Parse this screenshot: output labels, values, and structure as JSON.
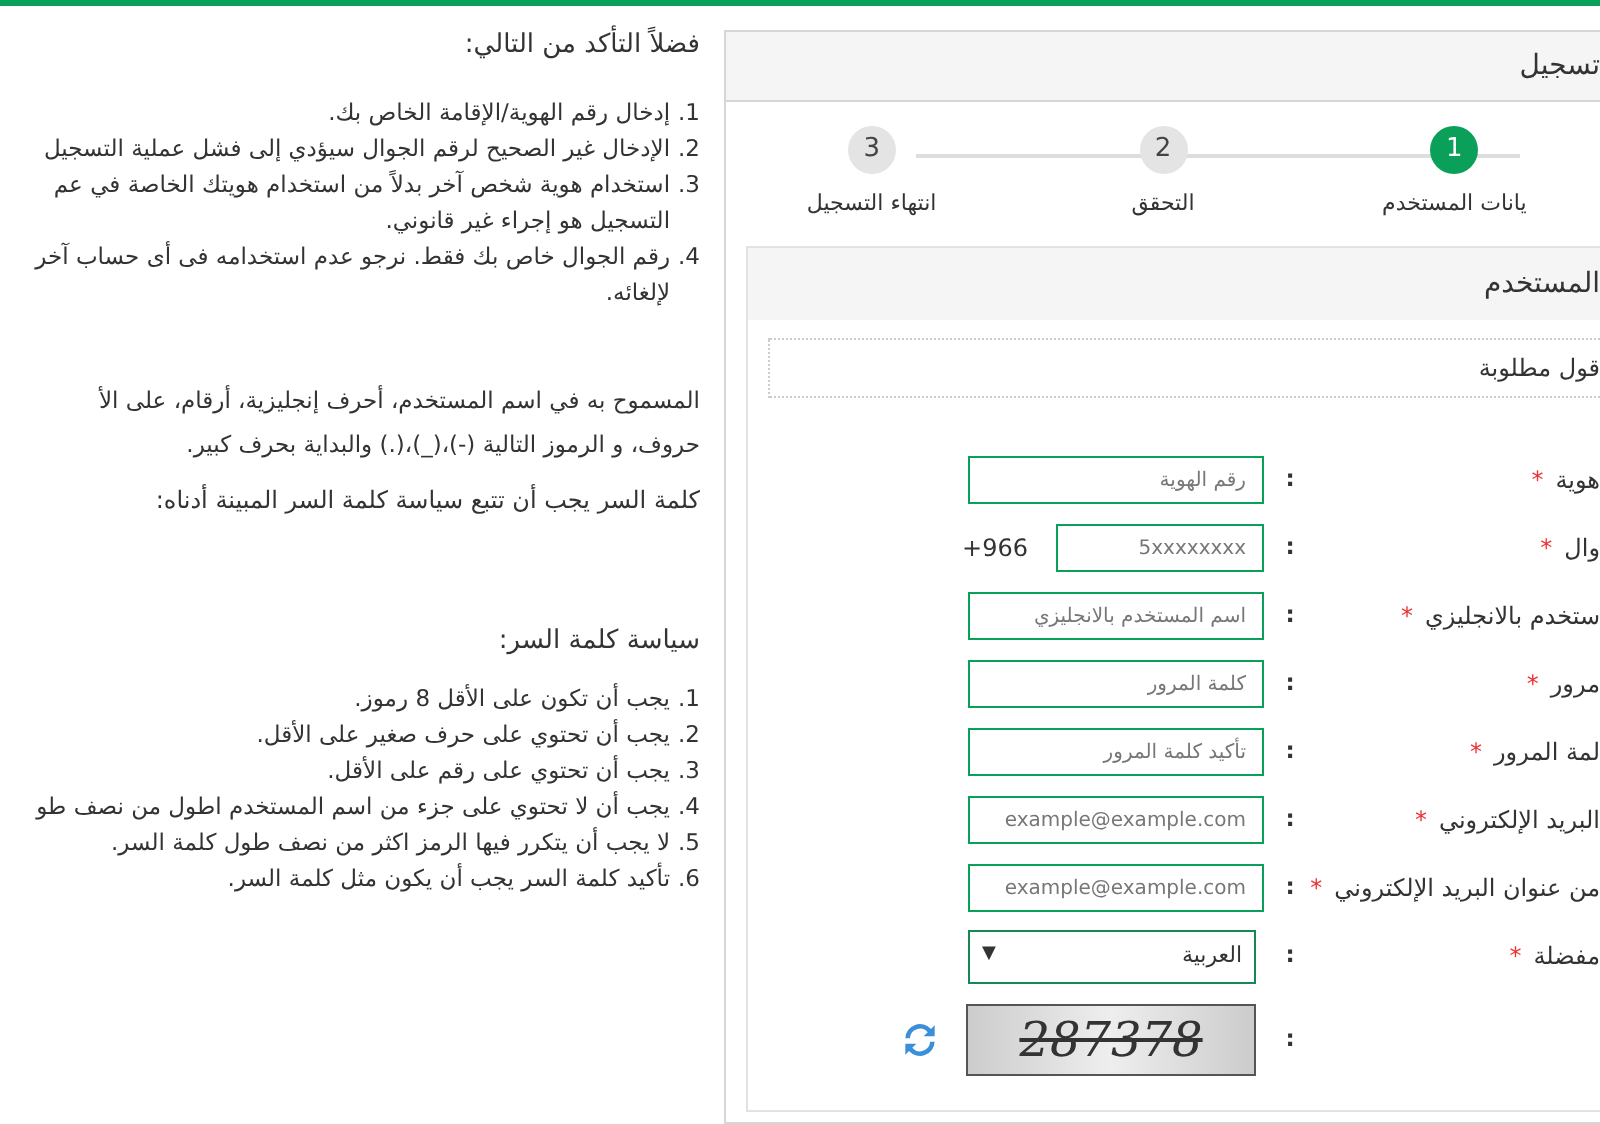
{
  "notes": {
    "title": "فضلاً التأكد من التالي:",
    "items": [
      {
        "number": "1.",
        "lines": [
          "إدخال رقم الهوية/الإقامة الخاص بك."
        ]
      },
      {
        "number": "2.",
        "lines": [
          "الإدخال غير الصحيح لرقم الجوال سيؤدي إلى فشل عملية التسجيل"
        ]
      },
      {
        "number": "3.",
        "lines": [
          "استخدام هوية شخص آخر بدلاً من استخدام هويتك الخاصة في عم",
          "التسجيل هو إجراء غير قانوني."
        ]
      },
      {
        "number": "4.",
        "lines": [
          "رقم الجوال خاص بك فقط. نرجو عدم استخدامه فى أى حساب آخر",
          "لإلغائه."
        ]
      }
    ]
  },
  "username_rules": {
    "lines": [
      "المسموح به في اسم المستخدم، أحرف إنجليزية، أرقام، على الأ",
      "حروف، و الرموز التالية (-)،(_)،(.) والبداية بحرف كبير."
    ]
  },
  "password_note": "كلمة السر يجب أن تتبع سياسة كلمة السر المبينة أدناه:",
  "policy": {
    "title": "سياسة كلمة السر:",
    "items": [
      {
        "number": "1.",
        "lines": [
          "يجب أن تكون على الأقل 8 رموز."
        ]
      },
      {
        "number": "2.",
        "lines": [
          "يجب أن تحتوي على حرف صغير على الأقل."
        ]
      },
      {
        "number": "3.",
        "lines": [
          "يجب أن تحتوي على رقم على الأقل."
        ]
      },
      {
        "number": "4.",
        "lines": [
          "يجب أن لا تحتوي على جزء من اسم المستخدم اطول من نصف طو"
        ]
      },
      {
        "number": "5.",
        "lines": [
          "لا يجب أن يتكرر فيها الرمز اكثر من نصف طول كلمة السر."
        ]
      },
      {
        "number": "6.",
        "lines": [
          "تأكيد كلمة السر يجب أن يكون مثل كلمة السر."
        ]
      }
    ]
  },
  "registration": {
    "title": "تسجيل",
    "steps": [
      {
        "number": "1",
        "label": "يانات المستخدم",
        "selected": true
      },
      {
        "number": "2",
        "label": "التحقق",
        "selected": false
      },
      {
        "number": "3",
        "label": "انتهاء التسجيل",
        "selected": false
      }
    ],
    "user_card": {
      "title": "المستخدم",
      "required_note": "قول مطلوبة",
      "fields": [
        {
          "kind": "text",
          "label": "هوية",
          "required_mark": "*",
          "separator": ":",
          "placeholder": "رقم الهوية"
        },
        {
          "kind": "phone",
          "label": "وال",
          "required_mark": "*",
          "separator": ":",
          "prefix": "+966",
          "placeholder": "5xxxxxxxx"
        },
        {
          "kind": "text",
          "label": "ستخدم بالانجليزي",
          "required_mark": "*",
          "separator": ":",
          "placeholder": "اسم المستخدم بالانجليزي"
        },
        {
          "kind": "text",
          "label": "مرور",
          "required_mark": "*",
          "separator": ":",
          "placeholder": "كلمة المرور"
        },
        {
          "kind": "text",
          "label": "لمة المرور",
          "required_mark": "*",
          "separator": ":",
          "placeholder": "تأكيد كلمة المرور"
        },
        {
          "kind": "text",
          "label": "البريد الإلكتروني",
          "required_mark": "*",
          "separator": ":",
          "placeholder": "example@example.com"
        },
        {
          "kind": "text",
          "label": "من عنوان البريد الإلكتروني",
          "required_mark": "*",
          "separator": ":",
          "placeholder": "example@example.com"
        },
        {
          "kind": "select",
          "label": "مفضلة",
          "required_mark": "*",
          "separator": ":",
          "value": "العربية",
          "caret": "▼"
        },
        {
          "kind": "captcha",
          "separator": ":",
          "captcha_text": "287378"
        }
      ]
    }
  }
}
